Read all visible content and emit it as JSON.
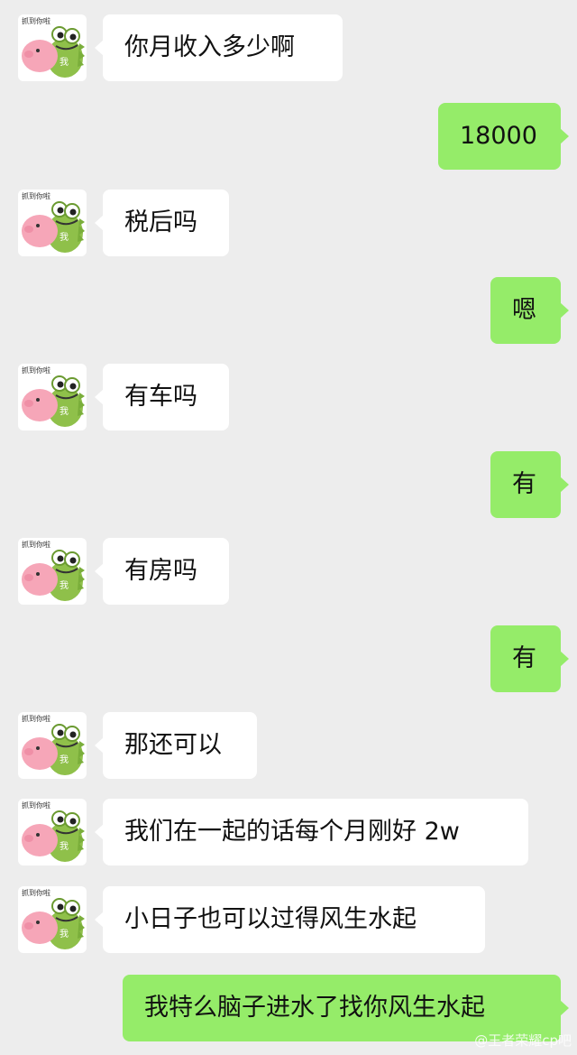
{
  "avatar": {
    "caption": "抓到你啦",
    "badge": "我",
    "name": "frog-pig-avatar"
  },
  "messages": [
    {
      "side": "left",
      "text": "你月收入多少啊"
    },
    {
      "side": "right",
      "text": "18000"
    },
    {
      "side": "left",
      "text": "税后吗"
    },
    {
      "side": "right",
      "text": "嗯"
    },
    {
      "side": "left",
      "text": "有车吗"
    },
    {
      "side": "right",
      "text": "有"
    },
    {
      "side": "left",
      "text": "有房吗"
    },
    {
      "side": "right",
      "text": "有"
    },
    {
      "side": "left",
      "text": "那还可以"
    },
    {
      "side": "left",
      "text": "我们在一起的话每个月刚好 2w"
    },
    {
      "side": "left",
      "text": "小日子也可以过得风生水起"
    },
    {
      "side": "right",
      "text": "我特么脑子进水了找你风生水起"
    }
  ],
  "watermark": "@王者荣耀cp吧",
  "colors": {
    "background": "#ededed",
    "incoming": "#ffffff",
    "outgoing": "#95ec69"
  }
}
